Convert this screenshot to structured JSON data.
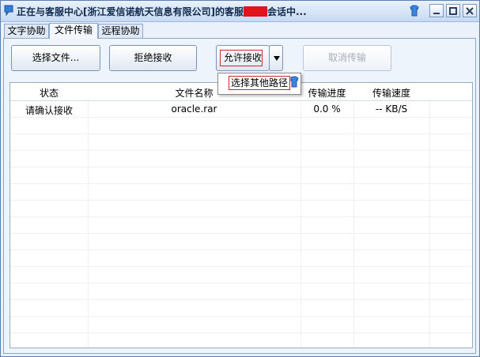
{
  "window": {
    "title_before": "正在与客服中心[浙江爱信诺航天信息有限公司]的客服",
    "title_after": "会话中..."
  },
  "tabs": [
    {
      "label": "文字协助"
    },
    {
      "label": "文件传输"
    },
    {
      "label": "远程协助"
    }
  ],
  "toolbar": {
    "select_file": "选择文件...",
    "reject": "拒绝接收",
    "allow": "允许接收",
    "cancel": "取消传输"
  },
  "dropdown": {
    "items": [
      "选择其他路径"
    ]
  },
  "table": {
    "columns": [
      "状态",
      "文件名称",
      "传输进度",
      "传输速度"
    ],
    "rows": [
      [
        "请确认接收",
        "oracle.rar",
        "0.0 %",
        "-- KB/S"
      ]
    ]
  },
  "colors": {
    "accent": "#5c7fae",
    "highlight_outline": "#d1262a",
    "redaction": "#e3131b"
  }
}
